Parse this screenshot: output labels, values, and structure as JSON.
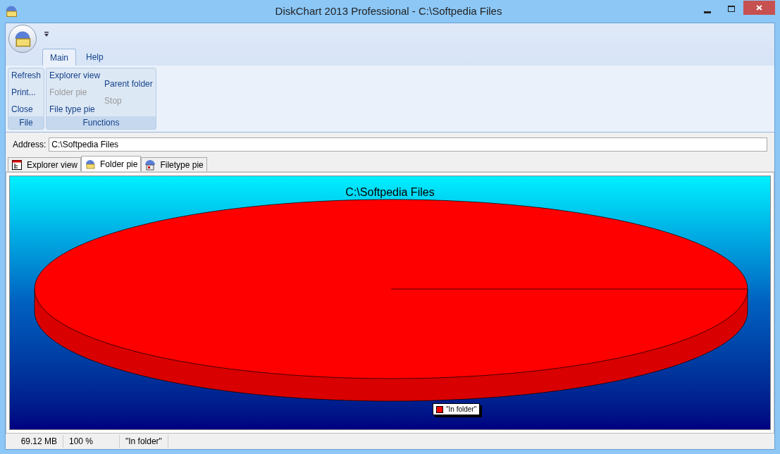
{
  "window": {
    "title": "DiskChart 2013 Professional - C:\\Softpedia Files"
  },
  "ribbon": {
    "tabs": [
      {
        "label": "Main",
        "selected": true
      },
      {
        "label": "Help",
        "selected": false
      }
    ],
    "groups": [
      {
        "label": "File",
        "columns": [
          [
            {
              "label": "Refresh",
              "disabled": false
            },
            {
              "label": "Print...",
              "disabled": false
            },
            {
              "label": "Close",
              "disabled": false
            }
          ]
        ]
      },
      {
        "label": "Functions",
        "columns": [
          [
            {
              "label": "Explorer view",
              "disabled": false
            },
            {
              "label": "Folder pie",
              "disabled": true
            },
            {
              "label": "File type pie",
              "disabled": false
            }
          ],
          [
            {
              "label": "Parent folder",
              "disabled": false
            },
            {
              "label": "Stop",
              "disabled": true
            }
          ]
        ]
      }
    ]
  },
  "address": {
    "label": "Address:",
    "value": "C:\\Softpedia Files"
  },
  "view_tabs": [
    {
      "label": "Explorer view",
      "kind": "tree",
      "selected": false
    },
    {
      "label": "Folder pie",
      "kind": "folder",
      "selected": true
    },
    {
      "label": "Filetype pie",
      "kind": "filetype",
      "selected": false
    }
  ],
  "chart": {
    "title": "C:\\Softpedia Files",
    "legend": [
      {
        "label": "\"In folder\"",
        "color": "#ff0000"
      }
    ]
  },
  "status_bar": [
    "69.12 MB",
    "100 %",
    "\"In folder\""
  ]
}
